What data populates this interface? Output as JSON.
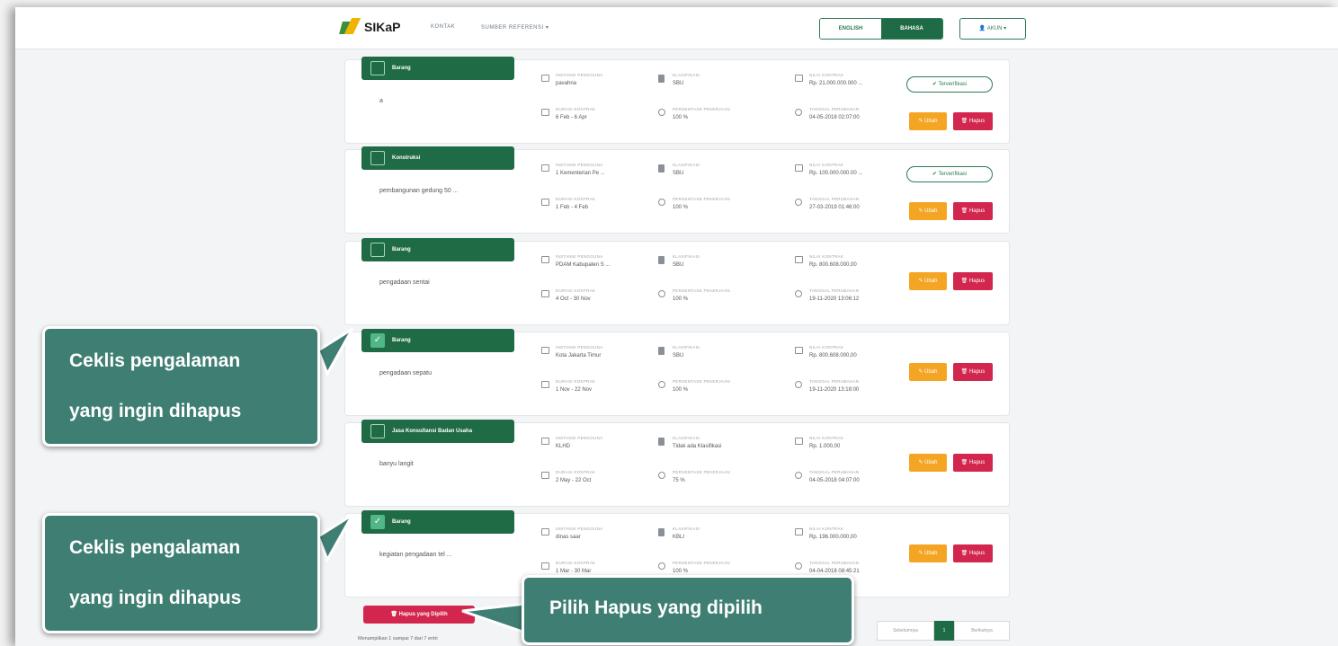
{
  "navbar": {
    "logo_text": "SIKaP",
    "links": [
      "KONTAK",
      "SUMBER REFERENSI ▾"
    ],
    "lang_english": "ENGLISH",
    "lang_bahasa": "BAHASA",
    "user_label": "👤 AKUN ▾"
  },
  "colors": {
    "brand_green": "#1f6b45",
    "accent_orange": "#f5a524",
    "danger_red": "#d3264e",
    "callout_teal": "#3f7f73"
  },
  "cards": [
    {
      "tag": "Barang",
      "checked": false,
      "project": "a",
      "instansi_label": "INSTANSI PENGGUNA",
      "instansi": "pavahna",
      "klasifikasi_label": "KLASIFIKASI",
      "klasifikasi": "SBU",
      "nilai_label": "NILAI KONTRAK",
      "nilai": "Rp. 21.000.000.000 ...",
      "durasi_label": "DURASI KONTRAK",
      "durasi": "6 Feb - 6 Apr",
      "progres_label": "PERSENTASE PEKERJAAN",
      "progres": "100 %",
      "tanggal_label": "TANGGAL PERUBAHAN",
      "tanggal": "04-05-2018 02:07:00",
      "verified": true
    },
    {
      "tag": "Konstruksi",
      "checked": false,
      "project": "pembangunan gedung 50 ...",
      "instansi_label": "INSTANSI PENGGUNA",
      "instansi": "1 Kementerian Pe ...",
      "klasifikasi_label": "KLASIFIKASI",
      "klasifikasi": "SBU",
      "nilai_label": "NILAI KONTRAK",
      "nilai": "Rp. 100.000.000.00 ...",
      "durasi_label": "DURASI KONTRAK",
      "durasi": "1 Feb - 4 Feb",
      "progres_label": "PERSENTASE PEKERJAAN",
      "progres": "100 %",
      "tanggal_label": "TANGGAL PERUBAHAN",
      "tanggal": "27-03-2019 01:46:00",
      "verified": true
    },
    {
      "tag": "Barang",
      "checked": false,
      "project": "pengadaan sentai",
      "instansi_label": "INSTANSI PENGGUNA",
      "instansi": "PDAM Kabupaten S ...",
      "klasifikasi_label": "KLASIFIKASI",
      "klasifikasi": "SBU",
      "nilai_label": "NILAI KONTRAK",
      "nilai": "Rp. 800.608.000,00",
      "durasi_label": "DURASI KONTRAK",
      "durasi": "4 Oct - 30 Nov",
      "progres_label": "PERSENTASE PEKERJAAN",
      "progres": "100 %",
      "tanggal_label": "TANGGAL PERUBAHAN",
      "tanggal": "19-11-2020 13:06:12",
      "verified": false
    },
    {
      "tag": "Barang",
      "checked": true,
      "project": "pengadaan sepatu",
      "instansi_label": "INSTANSI PENGGUNA",
      "instansi": "Kota Jakarta Timur",
      "klasifikasi_label": "KLASIFIKASI",
      "klasifikasi": "SBU",
      "nilai_label": "NILAI KONTRAK",
      "nilai": "Rp. 800.608.000,00",
      "durasi_label": "DURASI KONTRAK",
      "durasi": "1 Nov - 22 Nov",
      "progres_label": "PERSENTASE PEKERJAAN",
      "progres": "100 %",
      "tanggal_label": "TANGGAL PERUBAHAN",
      "tanggal": "19-11-2020 13:18:00",
      "verified": false
    },
    {
      "tag": "Jasa Konsultansi Badan Usaha",
      "checked": false,
      "project": "banyu langit",
      "instansi_label": "INSTANSI PENGGUNA",
      "instansi": "KLHD",
      "klasifikasi_label": "KLASIFIKASI",
      "klasifikasi": "Tidak ada Klasifikasi",
      "nilai_label": "NILAI KONTRAK",
      "nilai": "Rp. 1.000,00",
      "durasi_label": "DURASI KONTRAK",
      "durasi": "2 May - 22 Oct",
      "progres_label": "PERSENTASE PEKERJAAN",
      "progres": "75 %",
      "tanggal_label": "TANGGAL PERUBAHAN",
      "tanggal": "04-05-2018 04:07:00",
      "verified": false
    },
    {
      "tag": "Barang",
      "checked": true,
      "project": "kegiatan pengadaan tel ...",
      "instansi_label": "INSTANSI PENGGUNA",
      "instansi": "dinas saar",
      "klasifikasi_label": "KLASIFIKASI",
      "klasifikasi": "KBLI",
      "nilai_label": "NILAI KONTRAK",
      "nilai": "Rp. 196.000.000,00",
      "durasi_label": "DURASI KONTRAK",
      "durasi": "1 Mar - 30 Mar",
      "progres_label": "PERSENTASE PEKERJAAN",
      "progres": "100 %",
      "tanggal_label": "TANGGAL PERUBAHAN",
      "tanggal": "04-04-2018 08:45:21",
      "verified": false
    }
  ],
  "card_buttons": {
    "verified": "✔ Terverifikasi",
    "edit": "✎ Ubah",
    "delete": "🗑 Hapus"
  },
  "footer": {
    "delete_selected": "🗑 Hapus yang Dipilih",
    "showing": "Menampilkan 1 sampai 7 dari 7 entri",
    "prev": "Sebelumnya",
    "page": "1",
    "next": "Berikutnya"
  },
  "callouts": {
    "check1_line1": "Ceklis pengalaman",
    "check1_line2": "yang ingin dihapus",
    "check2_line1": "Ceklis pengalaman",
    "check2_line2": "yang ingin dihapus",
    "delete_hint": "Pilih Hapus yang dipilih"
  }
}
